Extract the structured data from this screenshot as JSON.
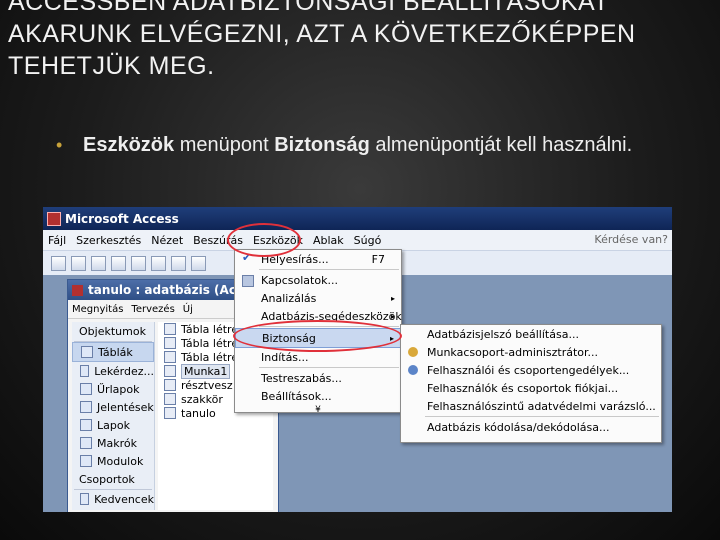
{
  "slide": {
    "title_lines": [
      "ACCESSBEN ADATBIZTONSÁGI BEÁLLÍTÁSOKAT",
      "AKARUNK ELVÉGEZNI, AZT A KÖVETKEZŐKÉPPEN",
      "TEHETJÜK MEG."
    ],
    "bullet": {
      "part1": "Eszközök",
      "part2": " menüpont ",
      "part3": "Biztonság",
      "part4": " almenüpontját kell használni."
    },
    "accent_color": "#c8a23a"
  },
  "app": {
    "title": "Microsoft Access",
    "menus": [
      "Fájl",
      "Szerkesztés",
      "Nézet",
      "Beszúrás",
      "Eszközök",
      "Ablak",
      "Súgó"
    ],
    "help_placeholder": "Kérdése van?"
  },
  "db_window": {
    "title": "tanulo : adatbázis (Acce",
    "tools": [
      "Megnyitás",
      "Tervezés",
      "Új"
    ],
    "objects_header": "Objektumok",
    "objects": [
      "Táblák",
      "Lekérdez...",
      "Űrlapok",
      "Jelentések",
      "Lapok",
      "Makrók",
      "Modulok"
    ],
    "groups_header": "Csoportok",
    "groups": [
      "Kedvencek"
    ],
    "items": [
      "Tábla létre",
      "Tábla létre",
      "Tábla létre",
      "Munka1",
      "résztvesz",
      "szakkör",
      "tanulo"
    ]
  },
  "tools_menu": {
    "items": [
      {
        "label": "Helyesírás...",
        "shortcut": "F7"
      },
      {
        "label": "Kapcsolatok..."
      },
      {
        "label": "Analizálás",
        "arrow": "▸"
      },
      {
        "label": "Adatbázis-segédeszközök",
        "arrow": "▸"
      },
      {
        "label": "Biztonság",
        "arrow": "▸"
      },
      {
        "label": "Indítás..."
      },
      {
        "label": "Testreszabás..."
      },
      {
        "label": "Beállítások..."
      }
    ],
    "expand": "¥"
  },
  "security_submenu": {
    "items": [
      "Adatbázisjelszó beállítása...",
      "Munkacsoport-adminisztrátor...",
      "Felhasználói és csoportengedélyek...",
      "Felhasználók és csoportok fiókjai...",
      "Felhasználószintű adatvédelmi varázsló...",
      "Adatbázis kódolása/dekódolása..."
    ]
  },
  "highlight_color": "#e0303a"
}
